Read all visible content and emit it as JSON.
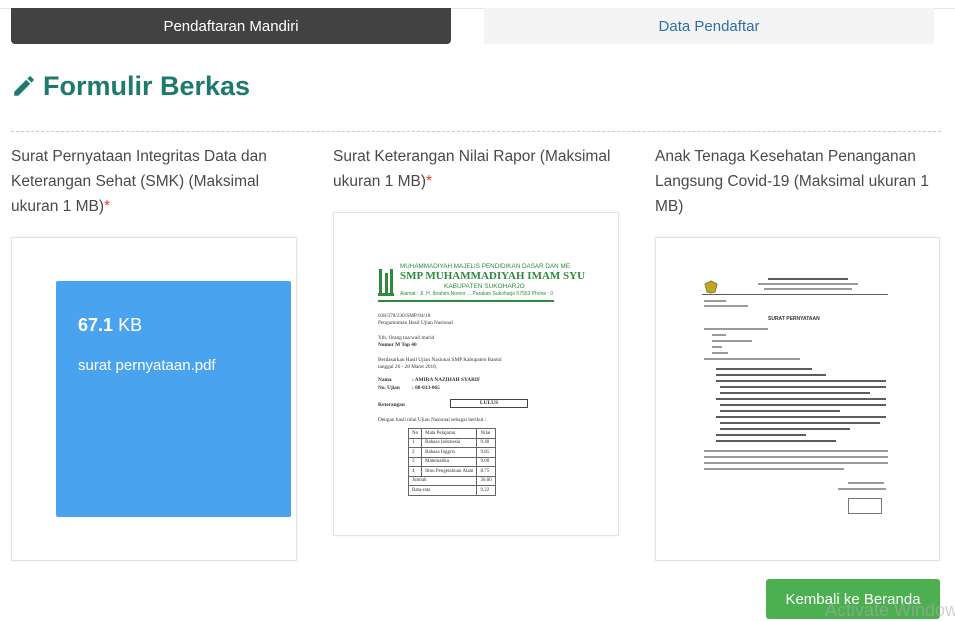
{
  "tabs": [
    {
      "label": "Pendaftaran Mandiri",
      "active": true
    },
    {
      "label": "Data Pendaftar",
      "active": false
    }
  ],
  "section": {
    "title": "Formulir Berkas",
    "icon": "pencil-icon",
    "color": "#1f7a6e"
  },
  "uploads": [
    {
      "label": "Surat Pernyataan Integritas Data dan Keterangan Sehat (SMK) (Maksimal ukuran 1 MB)",
      "required_mark": "*",
      "file": {
        "size_value": "67.1",
        "size_unit": "KB",
        "name": "surat pernyataan.pdf"
      }
    },
    {
      "label": "Surat Keterangan Nilai Rapor (Maksimal ukuran 1 MB)",
      "required_mark": "*",
      "preview": {
        "header_org": "MUHAMMADIYAH MAJELIS PENDIDIKAN DASAR DAN ME",
        "header_school": "SMP MUHAMMADIYAH IMAM SYU",
        "header_region": "KABUPATEN SUKOHARJO",
        "header_address": "Alamat : Jl. H. Ibrahim Nomor ... Parakan Sukoharjo 57553 Phone : 0",
        "letter_number": "038/378/230/SMP/04/18",
        "subject": "Pengumuman Hasil Ujian Nasional",
        "to": "Yth. Orang tua/wali murid",
        "group": "Nomor M Top 40",
        "intro": "Berdasarkan Hasil Ujian Nasional SMP Kabupaten Bantul",
        "intro_date": "tanggal 26 - 28 Maret 2018,",
        "name_label": "Nama",
        "name_value": ": AMIRA NAZIHAH SYARIF",
        "exam_label": "No. Ujian",
        "exam_value": ": 08-033-065",
        "status_label": "Keterangan",
        "status_value": "LULUS",
        "result_intro": "Dengan hasil nilai Ujian Nasional sebagai berikut :",
        "table_header": [
          "No",
          "Mata Pelajaran",
          "Nilai"
        ],
        "table_rows": [
          [
            "1",
            "Bahasa Indonesia",
            "9.40"
          ],
          [
            "2",
            "Bahasa Inggris",
            "9.85"
          ],
          [
            "3",
            "Matematika",
            "9.00"
          ],
          [
            "4",
            "Ilmu Pengetahuan Alam",
            "8.75"
          ]
        ],
        "total_label": "Jumlah",
        "total_value": "36.00",
        "avg_label": "Rata-rata",
        "avg_value": "9.22"
      }
    },
    {
      "label": "Anak Tenaga Kesehatan Penanganan Langsung Covid-19 (Maksimal ukuran 1 MB)",
      "preview": {
        "title": "SURAT PERNYATAAN"
      }
    }
  ],
  "back_button": {
    "label": "Kembali ke Beranda",
    "color": "#4caf50"
  },
  "watermark": "Activate Windows"
}
